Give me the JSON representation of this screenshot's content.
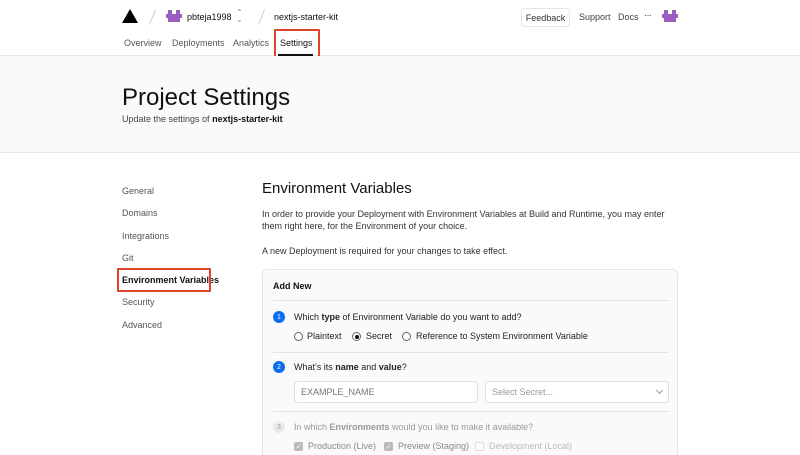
{
  "topbar": {
    "username": "pbteja1998",
    "project": "nextjs-starter-kit",
    "feedback": "Feedback",
    "support": "Support",
    "docs": "Docs",
    "more": "···"
  },
  "tabs": [
    {
      "label": "Overview"
    },
    {
      "label": "Deployments"
    },
    {
      "label": "Analytics"
    },
    {
      "label": "Settings"
    }
  ],
  "hero": {
    "title": "Project Settings",
    "subtitle_prefix": "Update the settings of",
    "subtitle_project": "nextjs-starter-kit"
  },
  "sidenav": [
    {
      "label": "General"
    },
    {
      "label": "Domains"
    },
    {
      "label": "Integrations"
    },
    {
      "label": "Git"
    },
    {
      "label": "Environment Variables"
    },
    {
      "label": "Security"
    },
    {
      "label": "Advanced"
    }
  ],
  "main": {
    "title": "Environment Variables",
    "para1": "In order to provide your Deployment with Environment Variables at Build and Runtime, you may enter them right here, for the Environment of your choice.",
    "para2": "A new Deployment is required for your changes to take effect.",
    "card": {
      "title": "Add New",
      "step1": {
        "num": "1",
        "q_pre": "Which ",
        "q_bold": "type",
        "q_post": " of Environment Variable do you want to add?",
        "options": [
          "Plaintext",
          "Secret",
          "Reference to System Environment Variable"
        ],
        "selected": "Secret"
      },
      "step2": {
        "num": "2",
        "q_pre": "What's its ",
        "q_bold1": "name",
        "q_mid": " and ",
        "q_bold2": "value",
        "q_post": "?",
        "name_placeholder": "EXAMPLE_NAME",
        "select_placeholder": "Select Secret..."
      },
      "step3": {
        "num": "3",
        "q_pre": "In which ",
        "q_bold": "Environments",
        "q_post": " would you like to make it available?",
        "checks": [
          {
            "label": "Production (Live)",
            "checked": true
          },
          {
            "label": "Preview (Staging)",
            "checked": true
          },
          {
            "label": "Development (Local)",
            "checked": false
          }
        ]
      }
    }
  },
  "colors": {
    "highlight": "#e0442a",
    "step_active": "#0b6cf0",
    "avatar": "#9b5fc0"
  }
}
